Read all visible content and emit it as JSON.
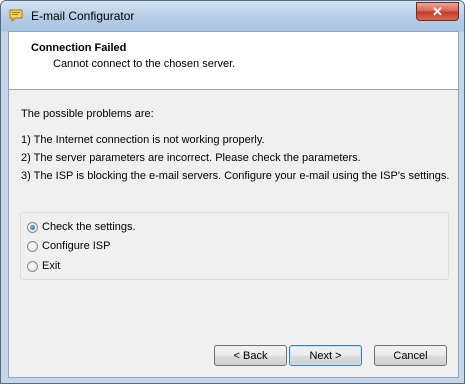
{
  "window": {
    "title": "E-mail Configurator",
    "close_glyph": "✕"
  },
  "header": {
    "title": "Connection Failed",
    "subtitle": "Cannot connect to the chosen server."
  },
  "body": {
    "intro": "The possible problems are:",
    "problems": [
      "1) The Internet connection is not working properly.",
      "2) The server parameters are incorrect. Please check the parameters.",
      "3) The ISP is blocking the e-mail servers. Configure your e-mail using the ISP's settings."
    ]
  },
  "options": [
    {
      "label": "Check the settings.",
      "checked": true
    },
    {
      "label": "Configure ISP",
      "checked": false
    },
    {
      "label": "Exit",
      "checked": false
    }
  ],
  "buttons": {
    "back": "< Back",
    "next": "Next >",
    "cancel": "Cancel"
  },
  "colors": {
    "title_bar": "#b3cbe6",
    "client_bg": "#f0f0f0",
    "close_button": "#c0392b"
  }
}
